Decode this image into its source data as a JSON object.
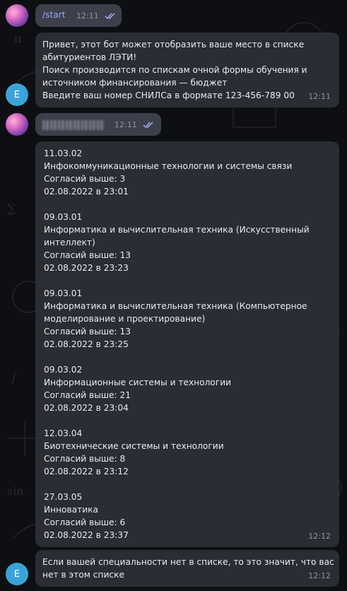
{
  "messages": [
    {
      "text": "/start",
      "time": "12:11"
    },
    {
      "lines": [
        "Привет, этот бот может отобразить ваше место в списке",
        "абитуриентов ЛЭТИ!",
        "Поиск производится по спискам очной формы обучения и",
        "источником финансирования — бюджет",
        "Введите ваш номер СНИЛСа в формате 123-456-789 00"
      ],
      "time": "12:11",
      "avatar": "E"
    },
    {
      "time": "12:11"
    },
    {
      "blocks": [
        {
          "code": "11.03.02",
          "name_lines": [
            "Инфокоммуникационные технологии и системы связи"
          ],
          "consents": "Согласий выше: 3",
          "date": "02.08.2022 в 23:01"
        },
        {
          "code": "09.03.01",
          "name_lines": [
            "Информатика и вычислительная техника (Искусственный",
            "интеллект)"
          ],
          "consents": "Согласий выше: 13",
          "date": "02.08.2022 в 23:23"
        },
        {
          "code": "09.03.01",
          "name_lines": [
            "Информатика и вычислительная техника (Компьютерное",
            "моделирование и проектирование)"
          ],
          "consents": "Согласий выше: 13",
          "date": "02.08.2022 в 23:25"
        },
        {
          "code": "09.03.02",
          "name_lines": [
            "Информационные системы и технологии"
          ],
          "consents": "Согласий выше: 21",
          "date": "02.08.2022 в 23:04"
        },
        {
          "code": "12.03.04",
          "name_lines": [
            "Биотехнические системы и технологии"
          ],
          "consents": "Согласий выше: 8",
          "date": "02.08.2022 в 23:12"
        },
        {
          "code": "27.03.05",
          "name_lines": [
            "Инноватика"
          ],
          "consents": "Согласий выше: 6",
          "date": "02.08.2022 в 23:37"
        }
      ],
      "time": "12:12"
    },
    {
      "lines": [
        "Если вашей специальности нет в списке, то это значит, что вас",
        "нет в этом списке"
      ],
      "time": "12:12",
      "avatar": "E"
    }
  ],
  "icons": {
    "read": "double-check-icon",
    "user_avatar": "user-avatar",
    "bot_avatar": "bot-avatar"
  },
  "colors": {
    "bubble_in": "#2a2d33",
    "bubble_out": "#3d3f4a",
    "accent": "#9aa7ff",
    "bot_avatar": "#3aa3d8"
  }
}
